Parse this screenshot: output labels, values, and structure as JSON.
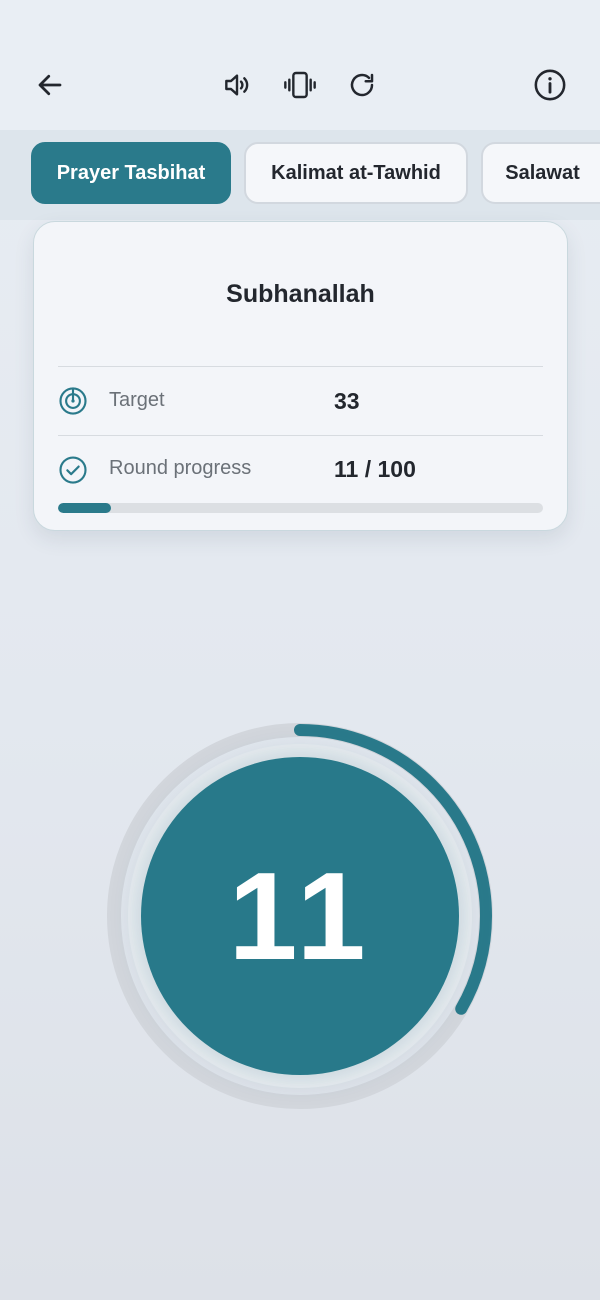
{
  "header": {
    "back_icon": "arrow-left-icon",
    "sound_icon": "speaker-icon",
    "vibrate_icon": "vibrate-icon",
    "reset_icon": "refresh-icon",
    "info_icon": "info-icon"
  },
  "tabs": [
    {
      "label": "Prayer Tasbihat",
      "active": true
    },
    {
      "label": "Kalimat at-Tawhid",
      "active": false
    },
    {
      "label": "Salawat",
      "active": false
    }
  ],
  "card": {
    "title": "Subhanallah",
    "target_label": "Target",
    "target_value": "33",
    "round_label": "Round progress",
    "round_value": "11 / 100",
    "round_progress_fraction": 0.11
  },
  "counter": {
    "value": "11",
    "ring_progress_fraction": 0.333
  },
  "colors": {
    "accent": "#2a7a8b",
    "counter_fill": "#28798a",
    "background": "#e5eaf0",
    "track": "#d2d6dc"
  }
}
